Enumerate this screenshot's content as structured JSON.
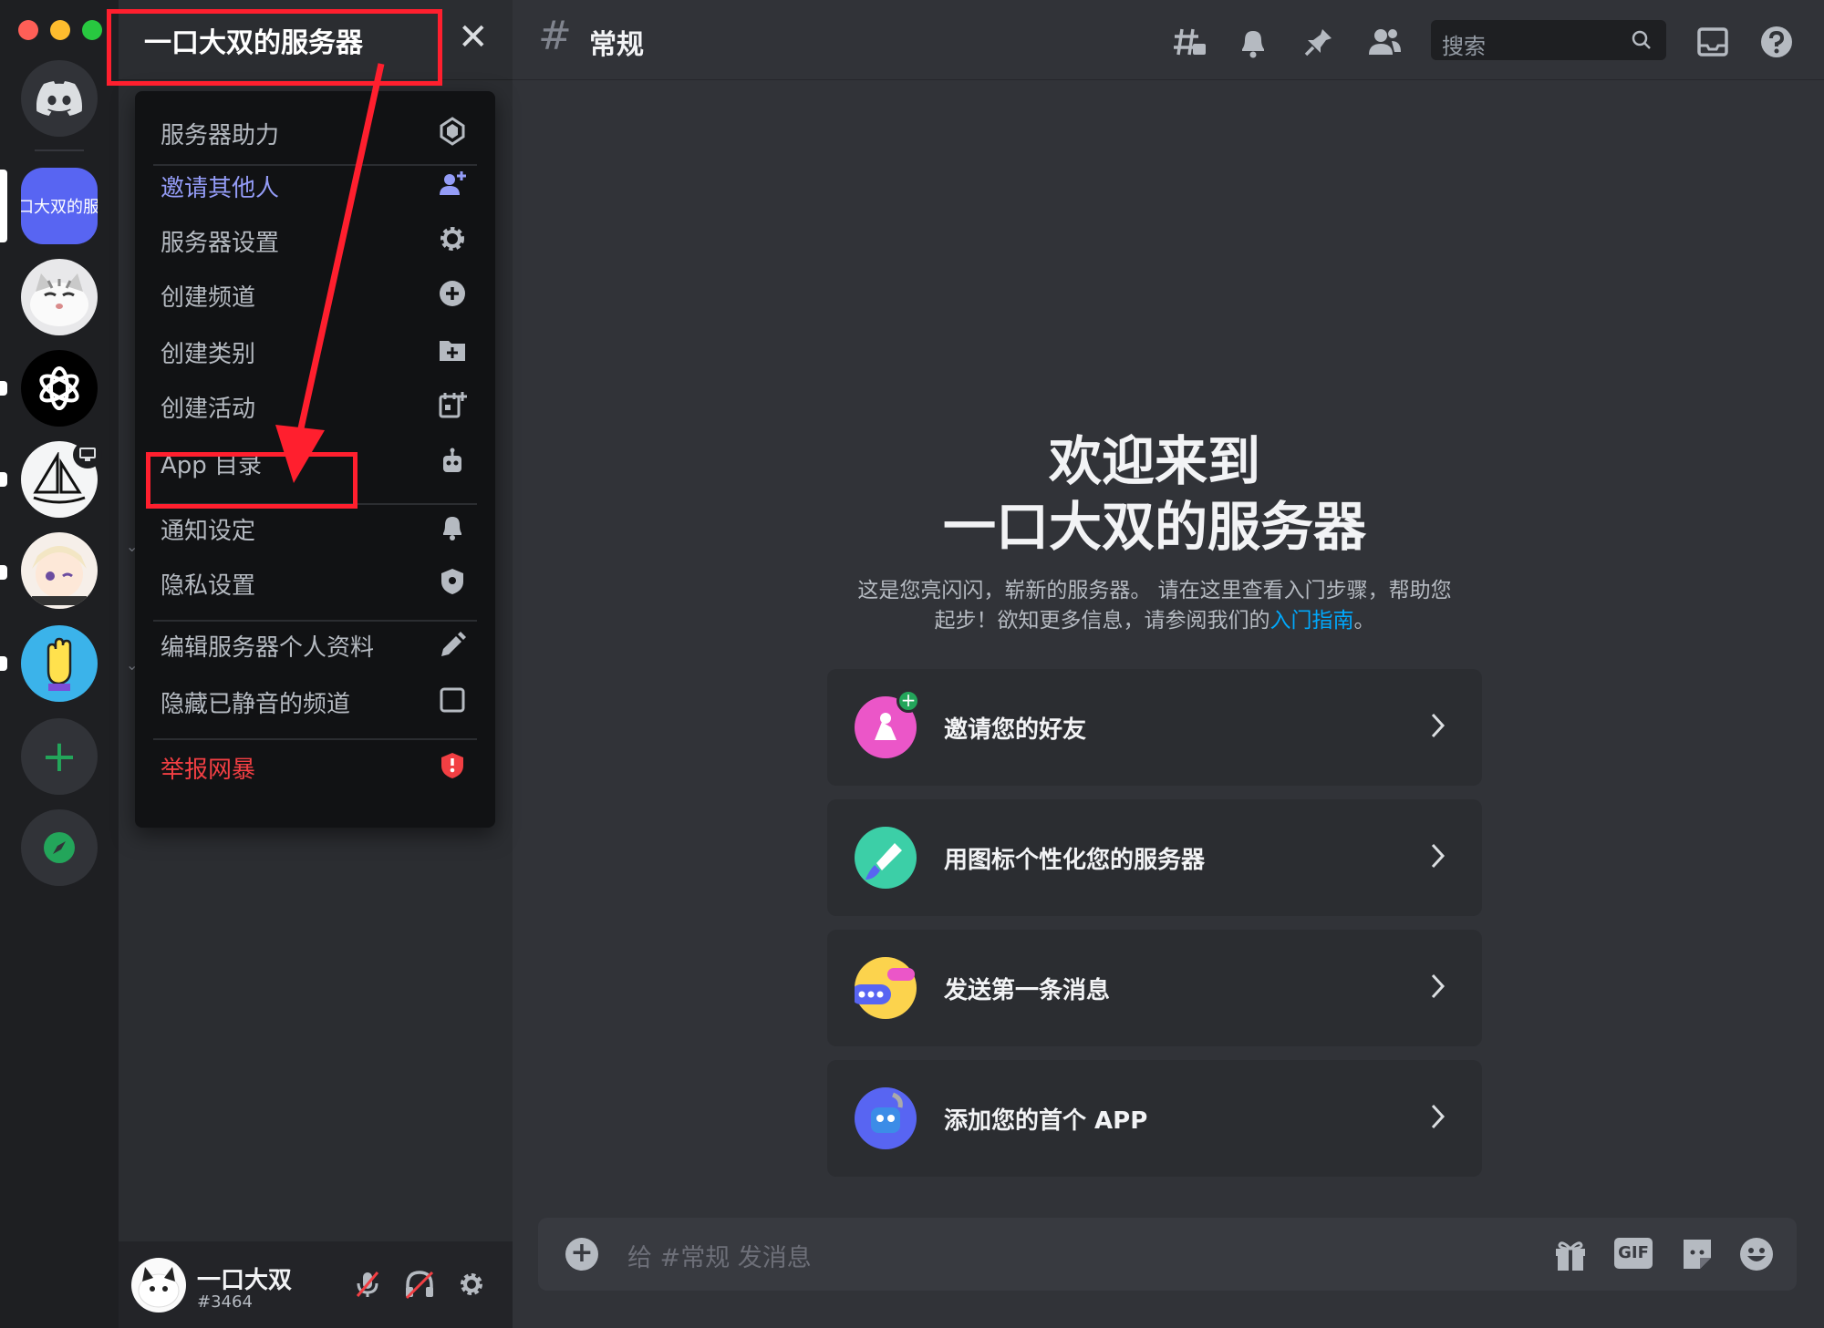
{
  "server": {
    "name": "一口大双的服务器",
    "active_tile_text": "口大双的服务器"
  },
  "menu": {
    "items": [
      {
        "label": "服务器助力"
      },
      {
        "label": "邀请其他人"
      },
      {
        "label": "服务器设置"
      },
      {
        "label": "创建频道"
      },
      {
        "label": "创建类别"
      },
      {
        "label": "创建活动"
      },
      {
        "label": "App 目录"
      },
      {
        "label": "通知设定"
      },
      {
        "label": "隐私设置"
      },
      {
        "label": "编辑服务器个人资料"
      },
      {
        "label": "隐藏已静音的频道"
      },
      {
        "label": "举报网暴"
      }
    ]
  },
  "channel": {
    "name": "常规",
    "hash": "#"
  },
  "search": {
    "placeholder": "搜索"
  },
  "welcome": {
    "title_line1": "欢迎来到",
    "title_line2": "一口大双的服务器",
    "desc_line1": "这是您亮闪闪，崭新的服务器。 请在这里查看入门步骤，帮助您",
    "desc_line2_pre": "起步！欲知更多信息，请参阅我们的",
    "desc_link": "入门指南",
    "desc_line2_post": "。"
  },
  "cards": [
    {
      "label": "邀请您的好友"
    },
    {
      "label": "用图标个性化您的服务器"
    },
    {
      "label": "发送第一条消息"
    },
    {
      "label": "添加您的首个 APP"
    }
  ],
  "composer": {
    "placeholder": "给 #常规 发消息",
    "gif_label": "GIF"
  },
  "user": {
    "name": "一口大双",
    "tag": "#3464"
  },
  "colors": {
    "accent_blue": "#5865f2",
    "link": "#00a8fc",
    "danger": "#f23f43",
    "green": "#23a55a",
    "annotation_red": "#ff1f2e"
  }
}
